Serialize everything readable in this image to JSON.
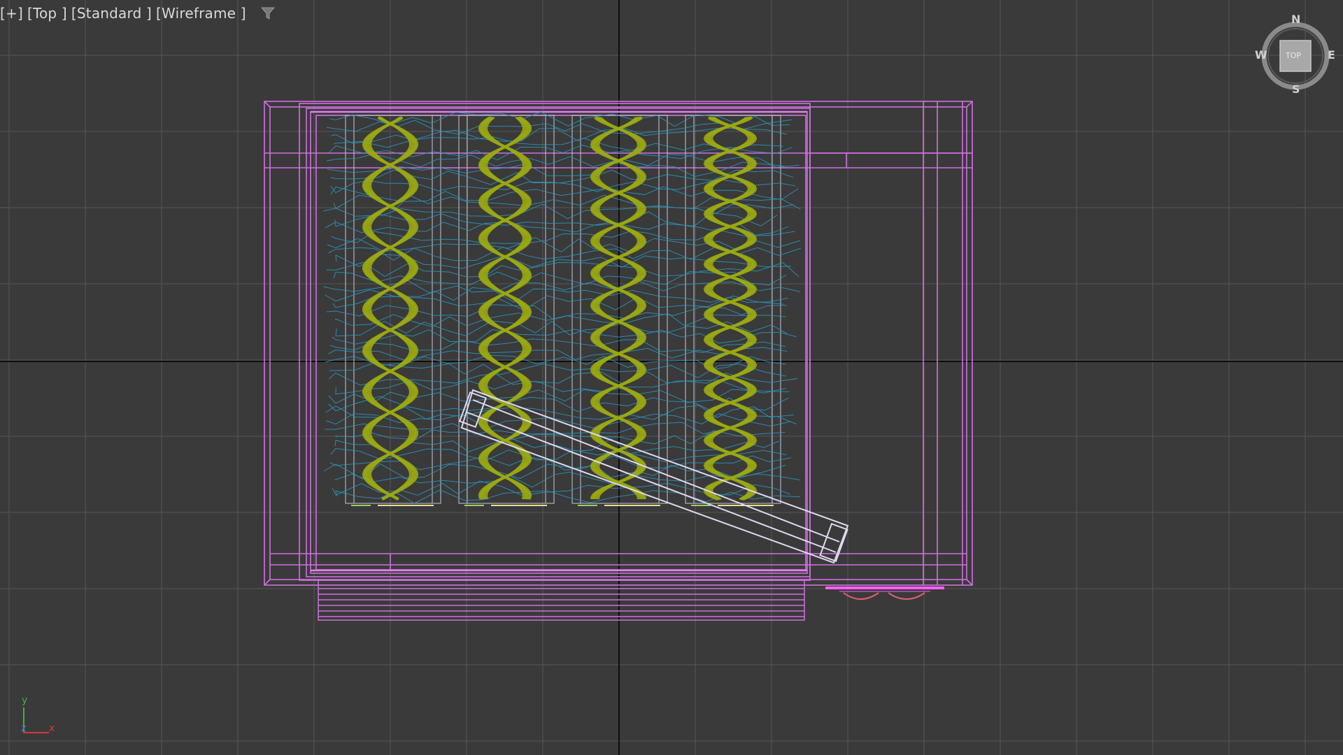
{
  "viewport": {
    "label_parts": [
      "[+]",
      "[Top ]",
      "[Standard ]",
      "[Wireframe ]"
    ],
    "filter_icon": "viewport-filter-icon"
  },
  "viewcube": {
    "north": "N",
    "south": "S",
    "east": "E",
    "west": "W",
    "face_label": "TOP"
  },
  "axis_tripod": {
    "y": "y",
    "z": "z",
    "x": "x"
  },
  "colors": {
    "background": "#3a3a3a",
    "grid_minor": "#545454",
    "grid_major": "#0e0e0e",
    "wire_magenta": "#d070e0",
    "helix_olive": "#9aa812",
    "vapor_cyan": "#2a98c0",
    "axis_y": "#3fb23f",
    "axis_x": "#d03b3b",
    "axis_z": "#4a6fd8"
  }
}
